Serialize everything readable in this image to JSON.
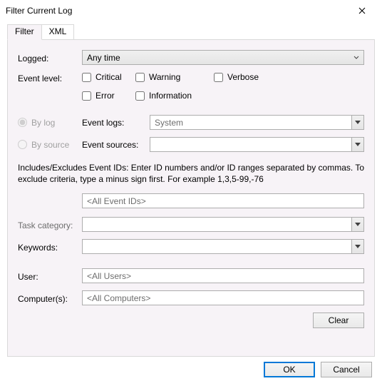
{
  "titlebar": {
    "title": "Filter Current Log"
  },
  "tabs": {
    "filter": "Filter",
    "xml": "XML"
  },
  "labels": {
    "logged": "Logged:",
    "event_level": "Event level:",
    "by_log": "By log",
    "by_source": "By source",
    "event_logs": "Event logs:",
    "event_sources": "Event sources:",
    "task_category": "Task category:",
    "keywords": "Keywords:",
    "user": "User:",
    "computers": "Computer(s):"
  },
  "logged_dropdown": {
    "selected": "Any time"
  },
  "event_levels": {
    "critical": "Critical",
    "warning": "Warning",
    "verbose": "Verbose",
    "error": "Error",
    "information": "Information"
  },
  "event_logs_value": "System",
  "event_sources_value": "",
  "help_text": "Includes/Excludes Event IDs: Enter ID numbers and/or ID ranges separated by commas. To exclude criteria, type a minus sign first. For example 1,3,5-99,-76",
  "event_ids_value": "<All Event IDs>",
  "task_category_value": "",
  "keywords_value": "",
  "user_value": "<All Users>",
  "computers_value": "<All Computers>",
  "buttons": {
    "clear": "Clear",
    "ok": "OK",
    "cancel": "Cancel"
  }
}
